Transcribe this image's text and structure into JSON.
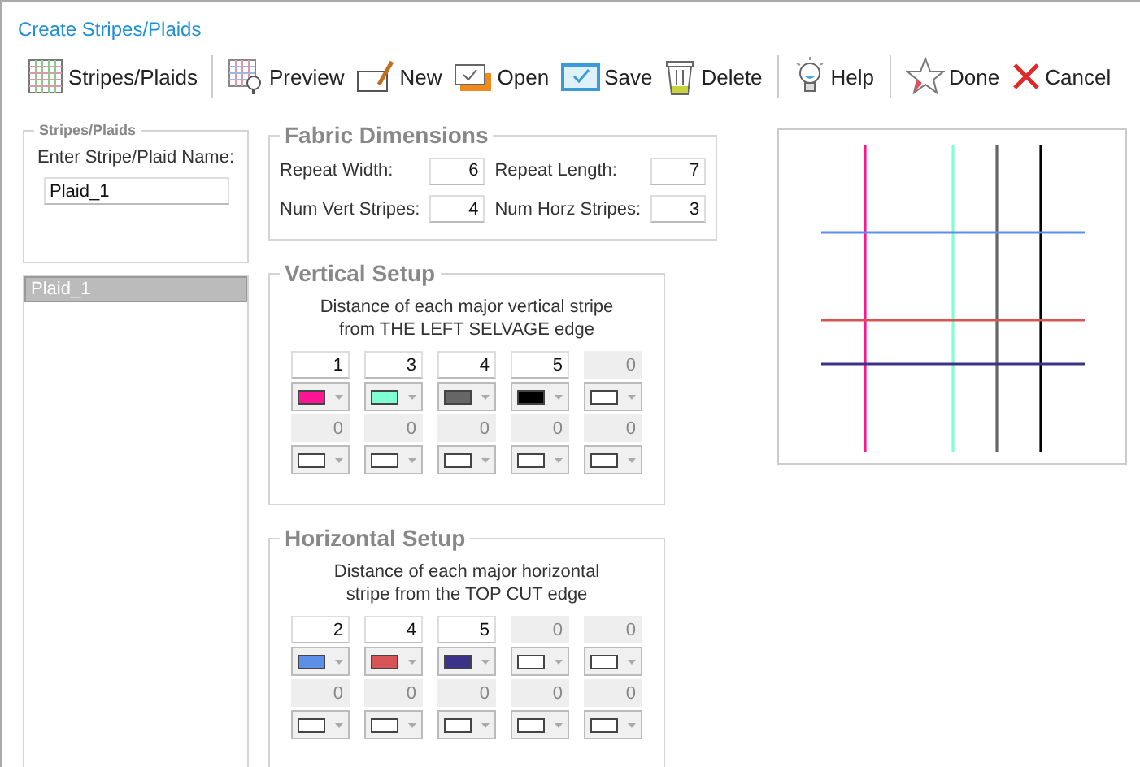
{
  "window": {
    "title": "Create Stripes/Plaids"
  },
  "toolbar": [
    [
      {
        "kind": "grid",
        "label": "Stripes/Plaids"
      }
    ],
    [
      {
        "kind": "preview",
        "label": "Preview"
      },
      {
        "kind": "new",
        "label": "New"
      },
      {
        "kind": "open",
        "label": "Open"
      },
      {
        "kind": "save",
        "label": "Save"
      },
      {
        "kind": "delete",
        "label": "Delete"
      }
    ],
    [
      {
        "kind": "help",
        "label": "Help"
      }
    ],
    [
      {
        "kind": "done",
        "label": "Done"
      },
      {
        "kind": "cancel",
        "label": "Cancel"
      }
    ]
  ],
  "stripes_plaids": {
    "title": "Stripes/Plaids",
    "name_label": "Enter Stripe/Plaid Name:",
    "name_value": "Plaid_1"
  },
  "list": [
    {
      "label": "Plaid_1",
      "selected": true
    }
  ],
  "fabric_dimensions": {
    "title": "Fabric Dimensions",
    "fields": [
      {
        "label": "Repeat Width:",
        "value": "6"
      },
      {
        "label": "Repeat Length:",
        "value": "7"
      },
      {
        "label": "Num Vert Stripes:",
        "value": "4"
      },
      {
        "label": "Num Horz Stripes:",
        "value": "3"
      }
    ]
  },
  "vertical_setup": {
    "title": "Vertical Setup",
    "description": "Distance of each major vertical stripe\nfrom THE LEFT SELVAGE edge",
    "stripes": [
      {
        "value": "1",
        "color": "#ff1493",
        "enabled": true
      },
      {
        "value": "3",
        "color": "#7fffd4",
        "enabled": true
      },
      {
        "value": "4",
        "color": "#666666",
        "enabled": true
      },
      {
        "value": "5",
        "color": "#000000",
        "enabled": true
      },
      {
        "value": "0",
        "color": "#ffffff",
        "enabled": false
      },
      {
        "value": "0",
        "color": "#ffffff",
        "enabled": false
      },
      {
        "value": "0",
        "color": "#ffffff",
        "enabled": false
      },
      {
        "value": "0",
        "color": "#ffffff",
        "enabled": false
      },
      {
        "value": "0",
        "color": "#ffffff",
        "enabled": false
      },
      {
        "value": "0",
        "color": "#ffffff",
        "enabled": false
      }
    ]
  },
  "horizontal_setup": {
    "title": "Horizontal Setup",
    "description": "Distance of each major horizontal\nstripe from the TOP CUT edge",
    "stripes": [
      {
        "value": "2",
        "color": "#5b8fe8",
        "enabled": true
      },
      {
        "value": "4",
        "color": "#d65454",
        "enabled": true
      },
      {
        "value": "5",
        "color": "#3a3388",
        "enabled": true
      },
      {
        "value": "0",
        "color": "#ffffff",
        "enabled": false
      },
      {
        "value": "0",
        "color": "#ffffff",
        "enabled": false
      },
      {
        "value": "0",
        "color": "#ffffff",
        "enabled": false
      },
      {
        "value": "0",
        "color": "#ffffff",
        "enabled": false
      },
      {
        "value": "0",
        "color": "#ffffff",
        "enabled": false
      },
      {
        "value": "0",
        "color": "#ffffff",
        "enabled": false
      },
      {
        "value": "0",
        "color": "#ffffff",
        "enabled": false
      }
    ]
  }
}
